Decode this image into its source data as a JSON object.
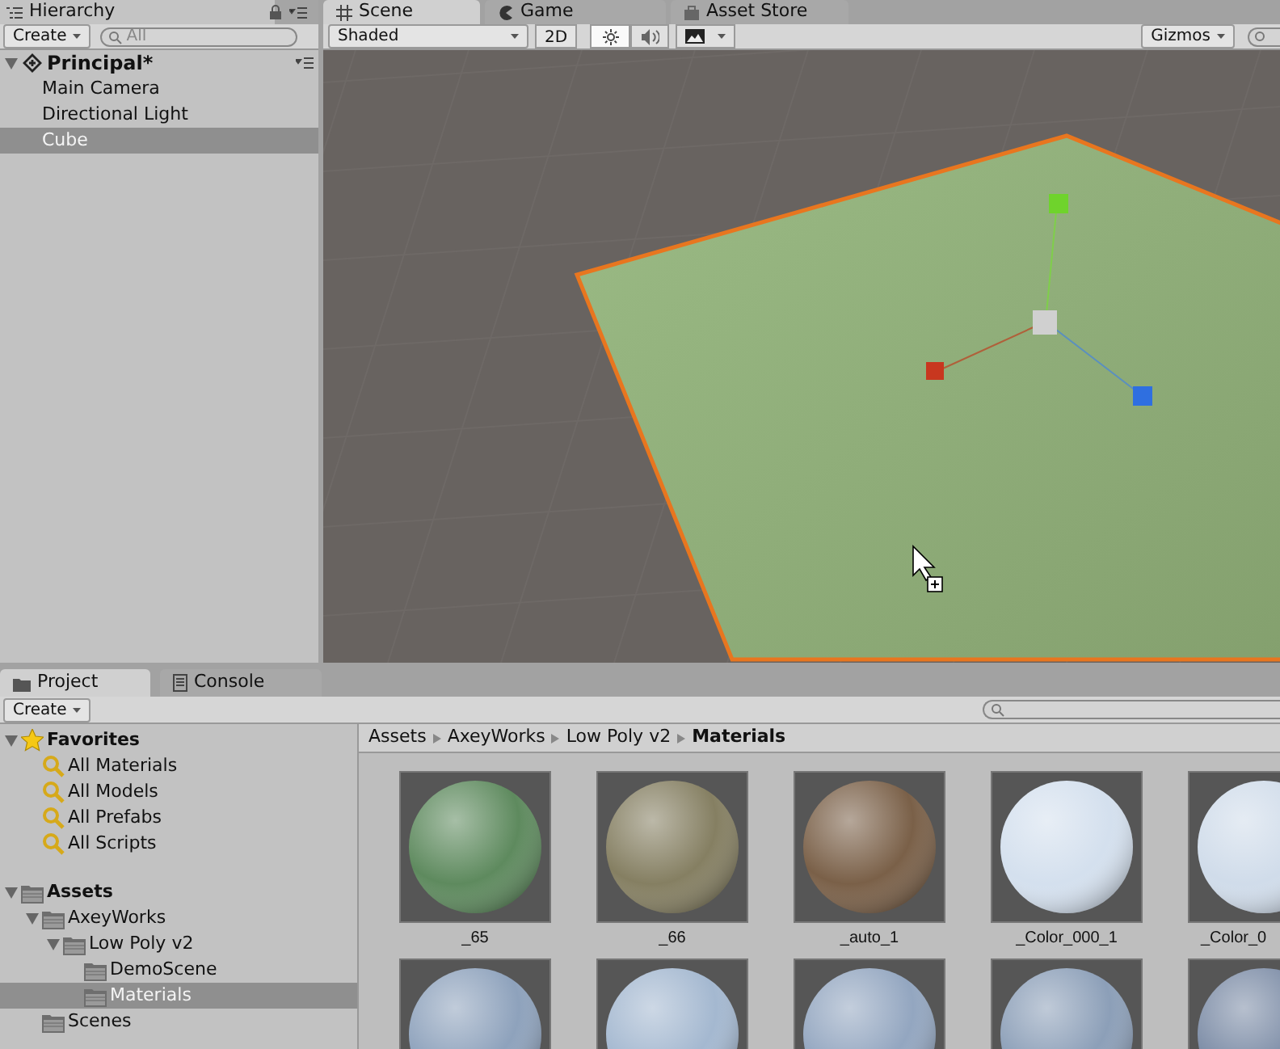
{
  "hierarchy": {
    "tab": {
      "label": "Hierarchy",
      "selected": true
    },
    "create_button": "Create",
    "search": {
      "placeholder": "All"
    },
    "scene": "Principal*",
    "items": [
      {
        "label": "Main Camera",
        "selected": false
      },
      {
        "label": "Directional Light",
        "selected": false
      },
      {
        "label": "Cube",
        "selected": true
      }
    ]
  },
  "scene_view": {
    "tabs": [
      {
        "label": "Scene",
        "kind": "grid",
        "selected": true
      },
      {
        "label": "Game",
        "kind": "pacman",
        "selected": false
      },
      {
        "label": "Asset Store",
        "kind": "bag",
        "selected": false
      }
    ],
    "shading": "Shaded",
    "mode_button": {
      "label": "2D",
      "selected": false
    },
    "lighting": {
      "on": true
    },
    "audio": {
      "on": false
    },
    "gizmos": "Gizmos"
  },
  "project": {
    "tabs": [
      {
        "label": "Project",
        "kind": "folder",
        "selected": true
      },
      {
        "label": "Console",
        "kind": "doc",
        "selected": false
      }
    ],
    "create_button": "Create",
    "tree": [
      {
        "label": "Favorites",
        "kind": "star",
        "expanded": true,
        "selected": false,
        "children": [
          {
            "label": "All Materials",
            "kind": "search",
            "selected": false
          },
          {
            "label": "All Models",
            "kind": "search",
            "selected": false
          },
          {
            "label": "All Prefabs",
            "kind": "search",
            "selected": false
          },
          {
            "label": "All Scripts",
            "kind": "search",
            "selected": false
          }
        ]
      },
      {
        "label": "Assets",
        "kind": "folder",
        "expanded": true,
        "selected": false,
        "children": [
          {
            "label": "AxeyWorks",
            "kind": "folder",
            "expanded": true,
            "selected": false,
            "children": [
              {
                "label": "Low Poly v2",
                "kind": "folder",
                "expanded": true,
                "selected": false,
                "children": [
                  {
                    "label": "DemoScene",
                    "kind": "folder",
                    "selected": false
                  },
                  {
                    "label": "Materials",
                    "kind": "folder",
                    "selected": true
                  }
                ]
              }
            ]
          },
          {
            "label": "Scenes",
            "kind": "folder",
            "selected": false
          }
        ]
      }
    ],
    "breadcrumb": [
      "Assets",
      "AxeyWorks",
      "Low Poly v2",
      "Materials"
    ],
    "materials": [
      {
        "label": "_65",
        "color": "#5e8a5e"
      },
      {
        "label": "_66",
        "color": "#857f62"
      },
      {
        "label": "_auto_1",
        "color": "#7a6048"
      },
      {
        "label": "_Color_000_1",
        "color": "#d4e0ee"
      },
      {
        "label": "_Color_0",
        "color": "#d0dcea"
      },
      {
        "color": "#8ea2bc"
      },
      {
        "color": "#a4b8d0"
      },
      {
        "color": "#93a6c0"
      },
      {
        "color": "#8c9fb8"
      },
      {
        "color": "#7c8ca6"
      }
    ]
  }
}
